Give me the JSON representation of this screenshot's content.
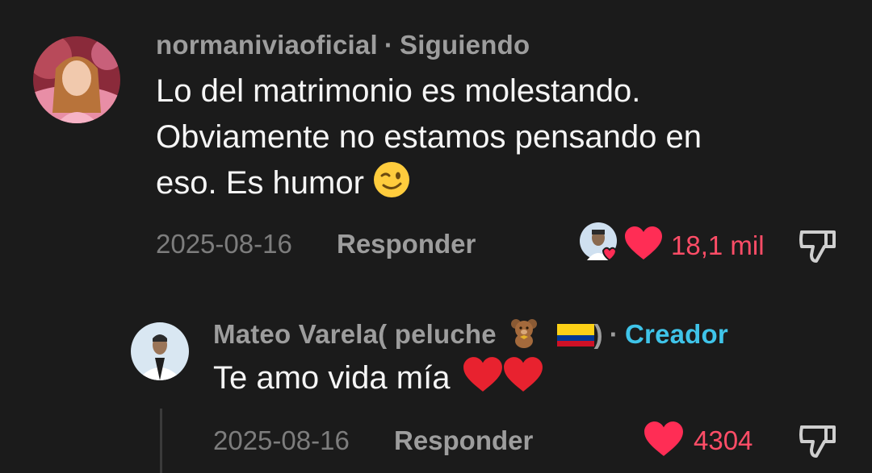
{
  "comment": {
    "username": "normaniviaoficial",
    "relation_sep": "·",
    "relation": "Siguiendo",
    "lines": [
      "Lo del matrimonio es molestando.",
      "Obviamente no estamos pensando en",
      "eso. Es humor"
    ],
    "emoji": "wink-emoji",
    "date": "2025-08-16",
    "reply_label": "Responder",
    "likes": "18,1 mil",
    "liked_by_creator": true
  },
  "reply": {
    "username": "Mateo Varela( peluche",
    "username_emojis": [
      "teddy-bear-emoji",
      "colombia-flag-emoji"
    ],
    "username_close": ")",
    "relation_sep": "·",
    "relation": "Creador",
    "text": "Te amo vida mía",
    "text_emojis": [
      "red-heart-emoji",
      "red-heart-emoji"
    ],
    "date": "2025-08-16",
    "reply_label": "Responder",
    "likes": "4304"
  },
  "colors": {
    "background": "#1b1b1b",
    "like_red": "#ff2d55",
    "creator_cyan": "#3fc4e9",
    "muted": "#9d9d9d"
  }
}
